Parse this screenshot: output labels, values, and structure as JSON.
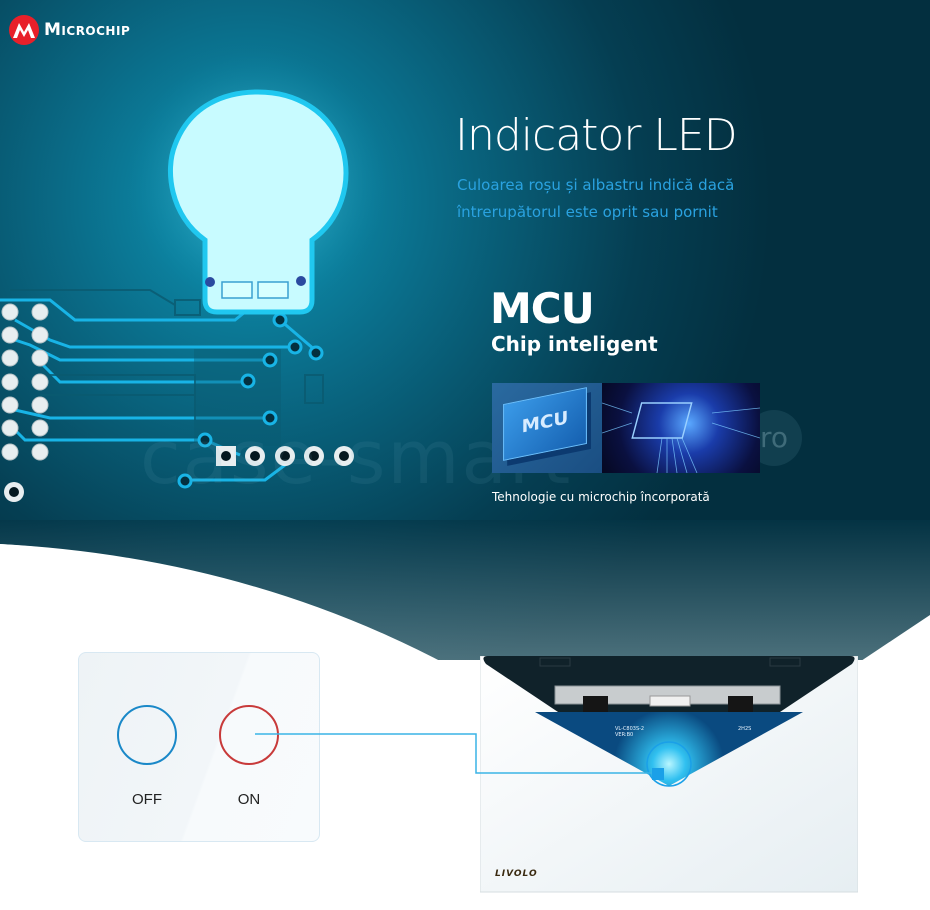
{
  "brand": {
    "logo_text": "Microchip",
    "logo_color": "#e8202a"
  },
  "led_section": {
    "title": "Indicator LED",
    "description": "Culoarea roșu și albastru indică dacă întrerupătorul este oprit sau pornit"
  },
  "mcu_section": {
    "title": "MCU",
    "subtitle": "Chip inteligent",
    "chip_label": "MCU",
    "caption": "Tehnologie cu microchip încorporată"
  },
  "watermark": {
    "text": "case-smart",
    "suffix": "ro"
  },
  "switch_panel": {
    "buttons": [
      {
        "label": "OFF",
        "ring_color": "#1a88c8"
      },
      {
        "label": "ON",
        "ring_color": "#c83a3a"
      }
    ]
  },
  "device": {
    "brand_label": "LIVOLO",
    "model_text_1": "VL-C803S-2",
    "model_text_2": "VER:B0",
    "model_text_3": "2H2S",
    "indicator_color": "#1aa0e8"
  },
  "colors": {
    "background_dark": "#04303f",
    "background_light": "#0a6f8a",
    "accent_blue": "#2aa2e0",
    "trace_blue": "#18b4e6"
  }
}
